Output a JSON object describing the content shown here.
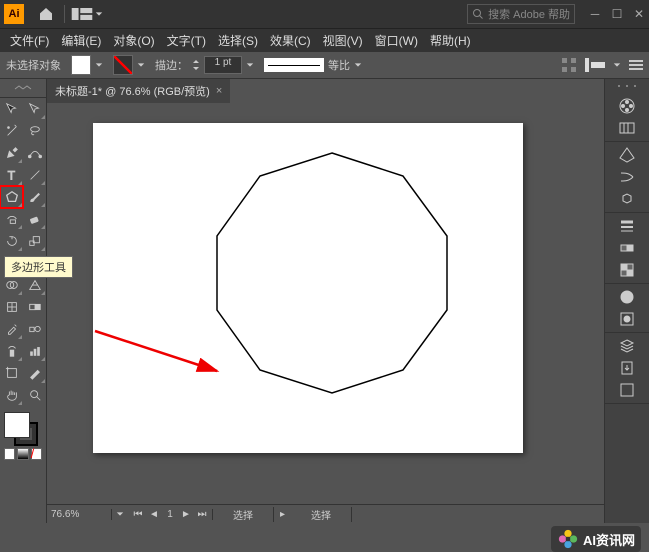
{
  "titlebar": {
    "logo": "Ai",
    "search_placeholder": "搜索 Adobe 帮助"
  },
  "menus": [
    "文件(F)",
    "编辑(E)",
    "对象(O)",
    "文字(T)",
    "选择(S)",
    "效果(C)",
    "视图(V)",
    "窗口(W)",
    "帮助(H)"
  ],
  "options": {
    "no_selection": "未选择对象",
    "stroke_label": "描边：",
    "stroke_pt": "1 pt",
    "uniform_label": "等比"
  },
  "doc": {
    "tab": "未标题-1* @ 76.6% (RGB/预览)",
    "zoom": "76.6%",
    "page": "1",
    "select": "选择"
  },
  "tooltip": "多边形工具",
  "logo_text": "AI资讯网",
  "chart_data": {
    "type": "polygon",
    "sides": 10,
    "stroke": "#000000",
    "fill": "none"
  }
}
